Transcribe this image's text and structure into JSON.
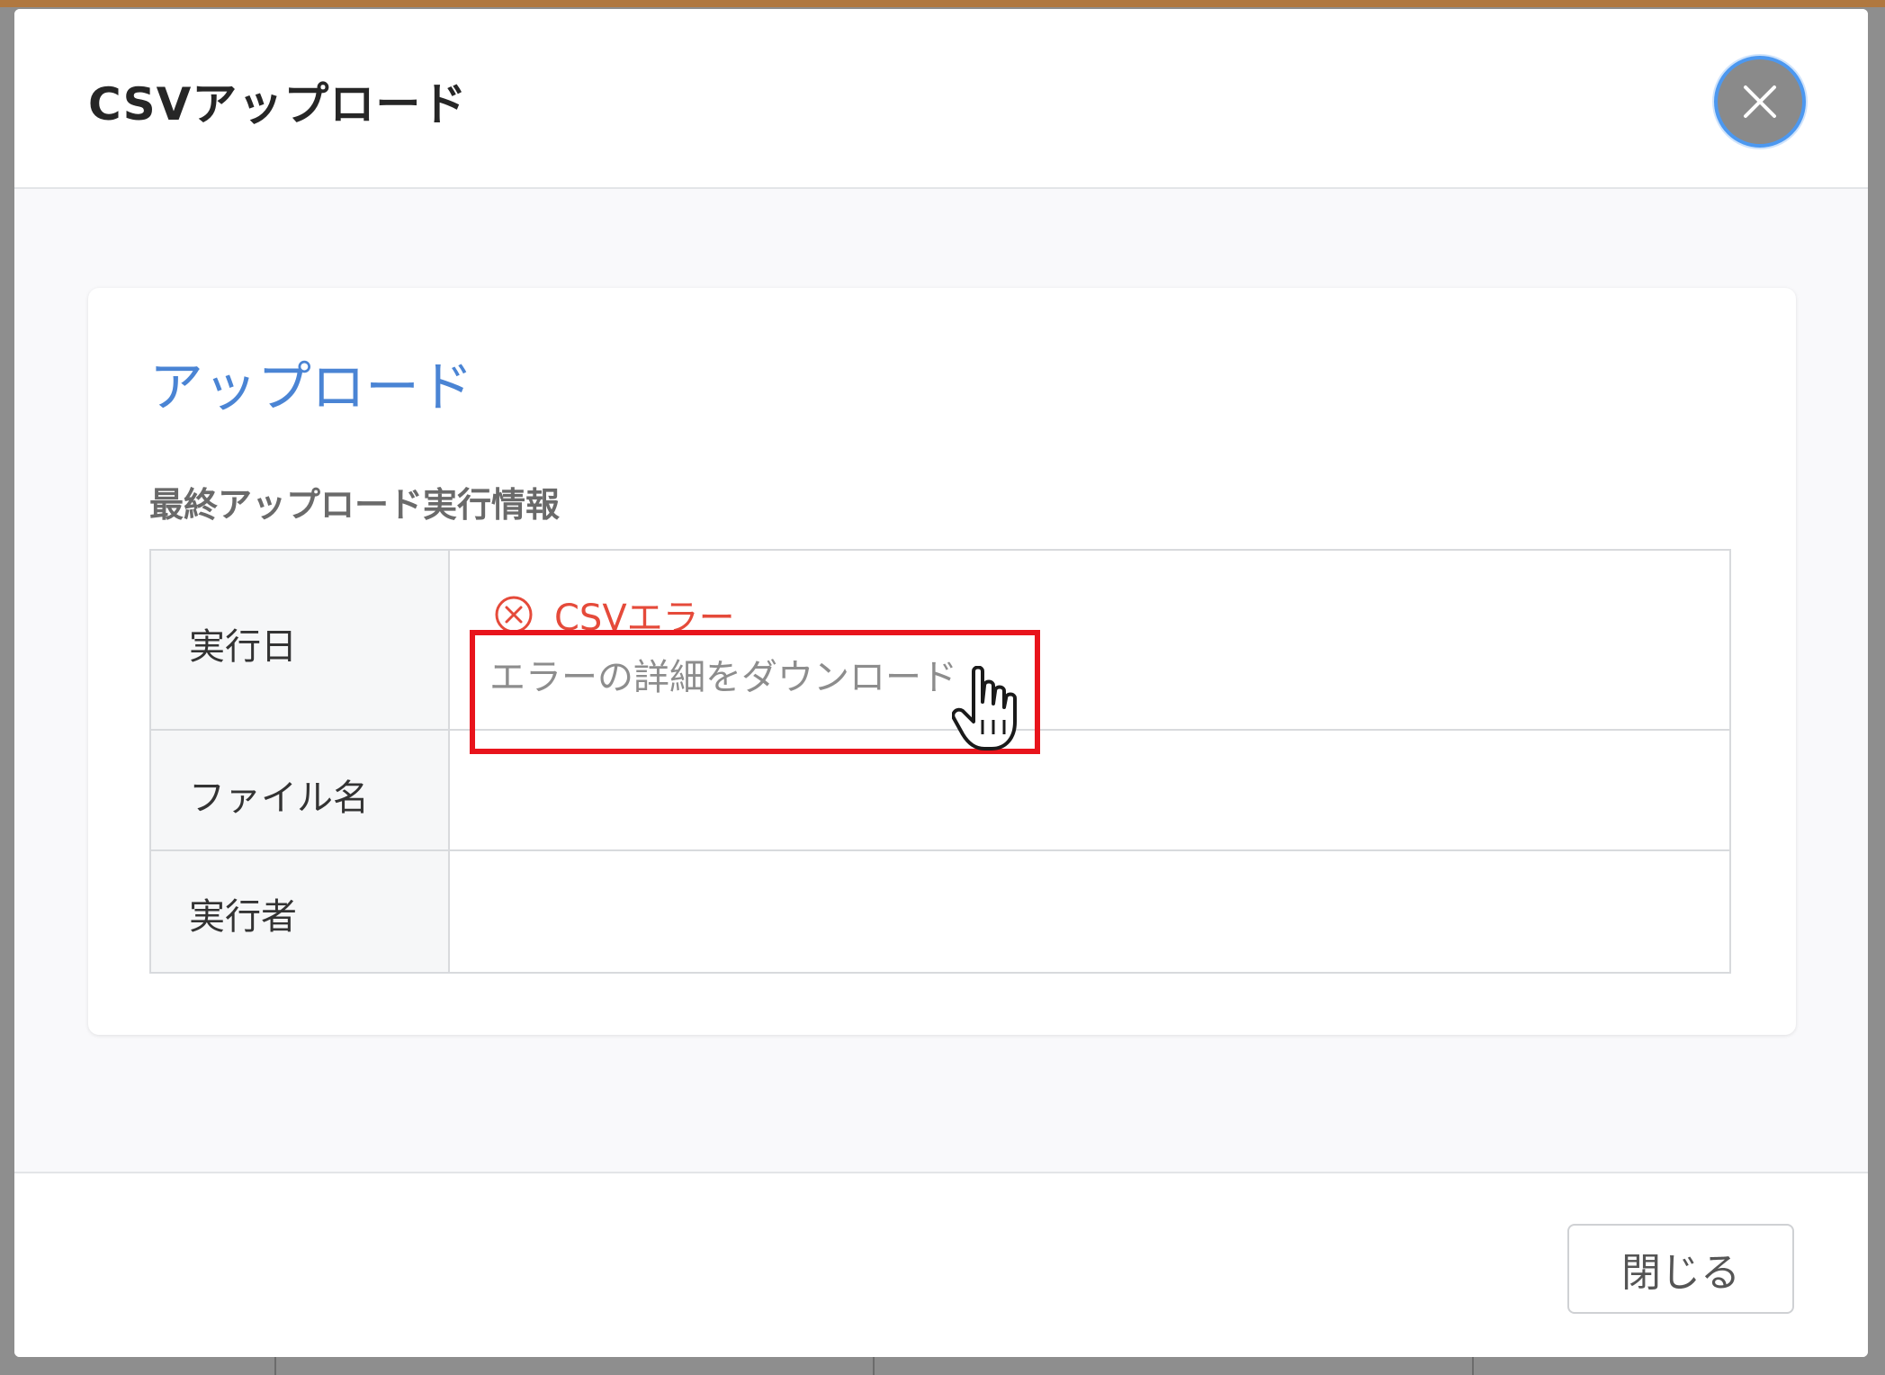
{
  "dialog": {
    "title": "CSVアップロード"
  },
  "card": {
    "title": "アップロード",
    "section_label": "最終アップロード実行情報"
  },
  "table": {
    "rows": [
      {
        "label": "実行日"
      },
      {
        "label": "ファイル名",
        "value": ""
      },
      {
        "label": "実行者",
        "value": ""
      }
    ]
  },
  "status": {
    "text": "CSVエラー",
    "icon": "error-circle-x-icon",
    "color": "#e54a3a"
  },
  "download": {
    "link_text": "エラーの詳細をダウンロード"
  },
  "footer": {
    "close_label": "閉じる"
  },
  "colors": {
    "accent": "#4a84d4",
    "error": "#e54a3a",
    "highlight": "#e8141c",
    "focus_ring": "#4c98f0"
  }
}
